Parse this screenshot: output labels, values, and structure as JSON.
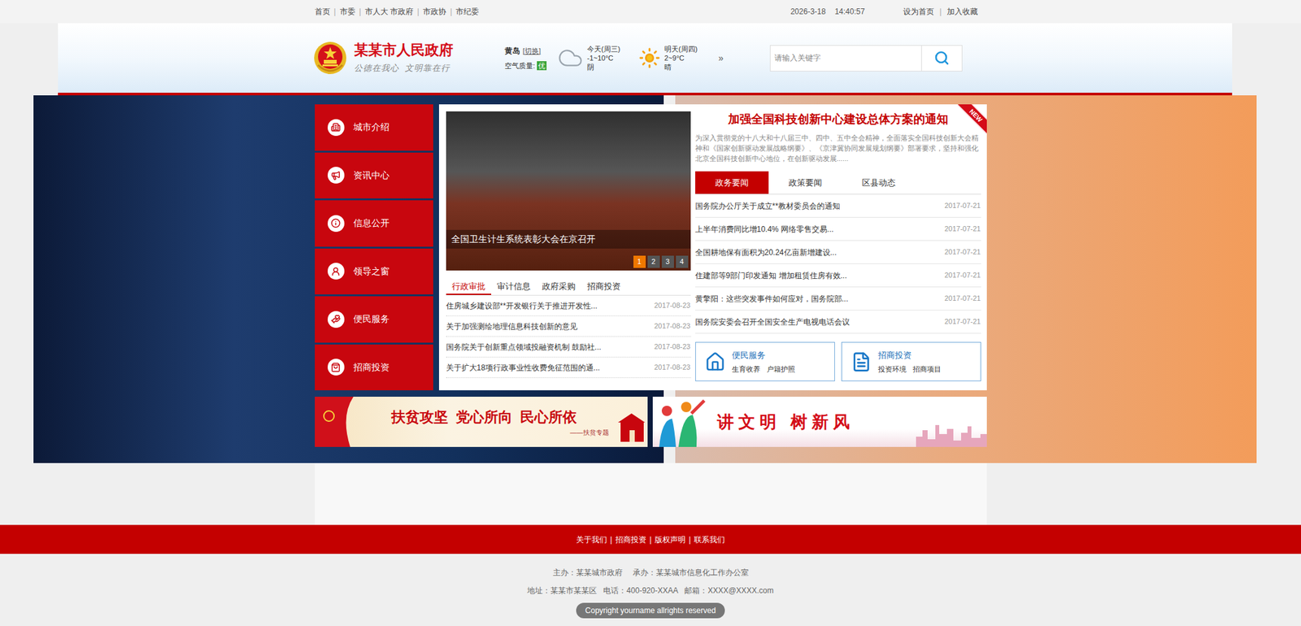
{
  "topbar": {
    "links": [
      "首页",
      "市委",
      "市人大 市政府",
      "市政协",
      "市纪委"
    ],
    "separator": "|",
    "date": "2026-3-18",
    "time": "14:40:57",
    "actions": [
      "设为首页",
      "加入收藏"
    ]
  },
  "header": {
    "title": "某某市人民政府",
    "slogan": "公德在我心  文明靠在行",
    "weather": {
      "city": "黄岛",
      "switch": "[切换]",
      "air_label": "空气质量:",
      "air_value": "优",
      "days": [
        {
          "label": "今天(周三)",
          "temp": "-1~10°C",
          "condition": "阴",
          "kind": "cloud"
        },
        {
          "label": "明天(周四)",
          "temp": "2~9°C",
          "condition": "晴",
          "kind": "sun"
        }
      ],
      "more": "»"
    },
    "search": {
      "placeholder": "请输入关键字"
    }
  },
  "side_menu": [
    {
      "label": "城市介绍"
    },
    {
      "label": "资讯中心"
    },
    {
      "label": "信息公开"
    },
    {
      "label": "领导之窗"
    },
    {
      "label": "便民服务"
    },
    {
      "label": "招商投资"
    }
  ],
  "slideshow": {
    "caption": "全国卫生计生系统表彰大会在京召开",
    "pages": [
      {
        "label": "1",
        "selected": true
      },
      {
        "label": "2",
        "selected": false
      },
      {
        "label": "3",
        "selected": false
      },
      {
        "label": "4",
        "selected": false
      }
    ]
  },
  "left_tabs": [
    {
      "label": "行政审批",
      "selected": true
    },
    {
      "label": "审计信息",
      "selected": false
    },
    {
      "label": "政府采购",
      "selected": false
    },
    {
      "label": "招商投资",
      "selected": false
    }
  ],
  "left_news": [
    {
      "title": "住房城乡建设部**开发银行关于推进开发性...",
      "date": "2017-08-23"
    },
    {
      "title": "关于加强测绘地理信息科技创新的意见",
      "date": "2017-08-23"
    },
    {
      "title": "国务院关于创新重点领域投融资机制 鼓励社...",
      "date": "2017-08-23"
    },
    {
      "title": "关于扩大18项行政事业性收费免征范围的通...",
      "date": "2017-08-23"
    }
  ],
  "feature": {
    "title": "加强全国科技创新中心建设总体方案的通知",
    "badge": "NEW",
    "summary": "为深入贯彻党的十八大和十八届三中、四中、五中全会精神，全面落实全国科技创新大会精神和《国家创新驱动发展战略纲要》、《京津冀协同发展规划纲要》部署要求，坚持和强化北京全国科技创新中心地位，在创新驱动发展......"
  },
  "right_tabs": [
    {
      "label": "政务要闻",
      "selected": true
    },
    {
      "label": "政策要闻",
      "selected": false
    },
    {
      "label": "区县动态",
      "selected": false
    }
  ],
  "right_news": [
    {
      "title": "国务院办公厅关于成立**教材委员会的通知",
      "date": "2017-07-21"
    },
    {
      "title": "上半年消费同比增10.4% 网络零售交易...",
      "date": "2017-07-21"
    },
    {
      "title": "全国耕地保有面积为20.24亿亩新增建设...",
      "date": "2017-07-21"
    },
    {
      "title": "住建部等9部门印发通知 增加租赁住房有效...",
      "date": "2017-07-21"
    },
    {
      "title": "黄擎阳：这些突发事件如何应对，国务院部...",
      "date": "2017-07-21"
    },
    {
      "title": "国务院安委会召开全国安全生产电视电话会议",
      "date": "2017-07-21"
    }
  ],
  "service_boxes": [
    {
      "title": "便民服务",
      "links": [
        "生育收养",
        "户籍护照"
      ]
    },
    {
      "title": "招商投资",
      "links": [
        "投资环境",
        "招商项目"
      ]
    }
  ],
  "banners": [
    {
      "title": "扶贫攻坚  党心所向  民心所依",
      "subtitle": "——扶贫专题"
    },
    {
      "title": "讲 文 明   树 新 风",
      "subtitle": ""
    }
  ],
  "footer": {
    "links": [
      "关于我们",
      "招商投资",
      "版权声明",
      "联系我们"
    ],
    "separator": "|",
    "host": "主办：某某城市政府",
    "organizer": "承办：某某城市信息化工作办公室",
    "address": "地址：某某市某某区",
    "phone": "电话：400-920-XXAA",
    "email": "邮箱：XXXX@XXXX.com",
    "copyright": "Copyright yourname allrights reserved"
  }
}
